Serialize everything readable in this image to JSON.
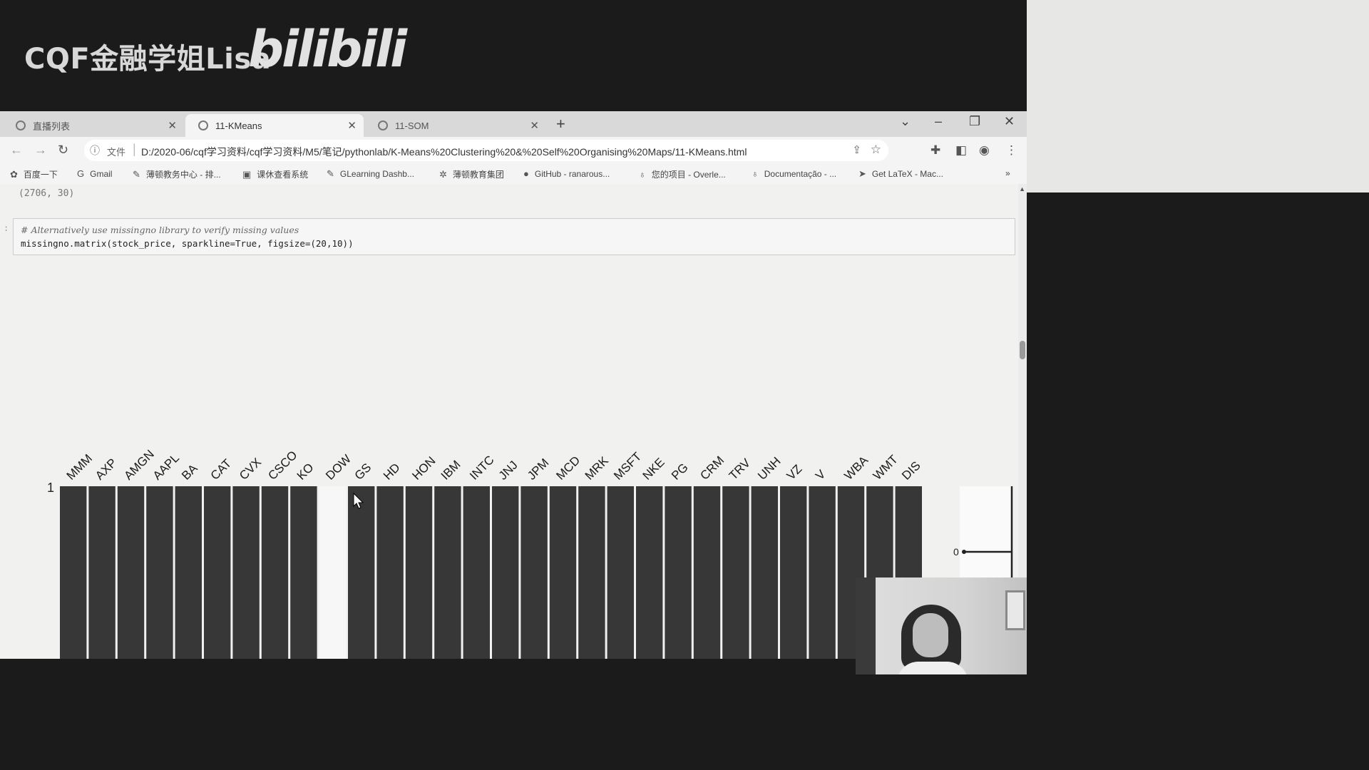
{
  "banner": {
    "channel_name": "CQF金融学姐Lisa",
    "logo_text": "bilibili"
  },
  "browser": {
    "tabs": [
      {
        "label": "直播列表",
        "active": false
      },
      {
        "label": "11-KMeans",
        "active": true
      },
      {
        "label": "11-SOM",
        "active": false
      }
    ],
    "new_tab": "+",
    "window_controls": {
      "tab_search": "⌄",
      "minimize": "–",
      "restore": "❐",
      "close": "✕"
    },
    "nav": {
      "back": "←",
      "forward": "→",
      "reload": "↻"
    },
    "address": {
      "info_icon": "ⓘ",
      "scheme_label": "文件",
      "url": "D:/2020-06/cqf学习资料/cqf学习资料/M5/笔记/pythonlab/K-Means%20Clustering%20&%20Self%20Organising%20Maps/11-KMeans.html"
    },
    "toolbar_icons": [
      "share-icon",
      "star-icon",
      "puzzle-icon",
      "sidepanel-icon",
      "profile-icon",
      "menu-icon"
    ],
    "bookmarks": [
      {
        "label": "百度一下",
        "icon": "✿"
      },
      {
        "label": "Gmail",
        "icon": "G"
      },
      {
        "label": "薄顿教务中心 - 排...",
        "icon": "✎"
      },
      {
        "label": "课休查看系统",
        "icon": "▣"
      },
      {
        "label": "GLearning Dashb...",
        "icon": "✎"
      },
      {
        "label": "薄顿教育集团",
        "icon": "✲"
      },
      {
        "label": "GitHub - ranarous...",
        "icon": "●"
      },
      {
        "label": "您的项目 - Overle...",
        "icon": "♁"
      },
      {
        "label": "Documentação - ...",
        "icon": "♁"
      },
      {
        "label": "Get LaTeX - Mac...",
        "icon": "➤"
      }
    ],
    "bookmarks_more": "»"
  },
  "notebook": {
    "prev_output": "(2706, 30)",
    "cell_prompt": ":",
    "code_comment": "# Alternatively use missingno library to verify missing values",
    "code_line": "missingno.matrix(stock_price, sparkline=True, figsize=(20,10))"
  },
  "chart_data": {
    "type": "heatmap",
    "title": "",
    "columns": [
      "MMM",
      "AXP",
      "AMGN",
      "AAPL",
      "BA",
      "CAT",
      "CVX",
      "CSCO",
      "KO",
      "DOW",
      "GS",
      "HD",
      "HON",
      "IBM",
      "INTC",
      "JNJ",
      "JPM",
      "MCD",
      "MRK",
      "MSFT",
      "NKE",
      "PG",
      "CRM",
      "TRV",
      "UNH",
      "VZ",
      "V",
      "WBA",
      "WMT",
      "DIS"
    ],
    "complete": [
      1,
      1,
      1,
      1,
      1,
      1,
      1,
      1,
      1,
      0,
      1,
      1,
      1,
      1,
      1,
      1,
      1,
      1,
      1,
      1,
      1,
      1,
      1,
      1,
      1,
      1,
      1,
      1,
      1,
      1
    ],
    "y_label_top": "1",
    "sparkline_label": "0",
    "colors": {
      "present": "#373737",
      "missing": "#f7f7f7",
      "separator": "#ffffff"
    }
  },
  "webcam": {
    "label": "presenter-webcam"
  }
}
